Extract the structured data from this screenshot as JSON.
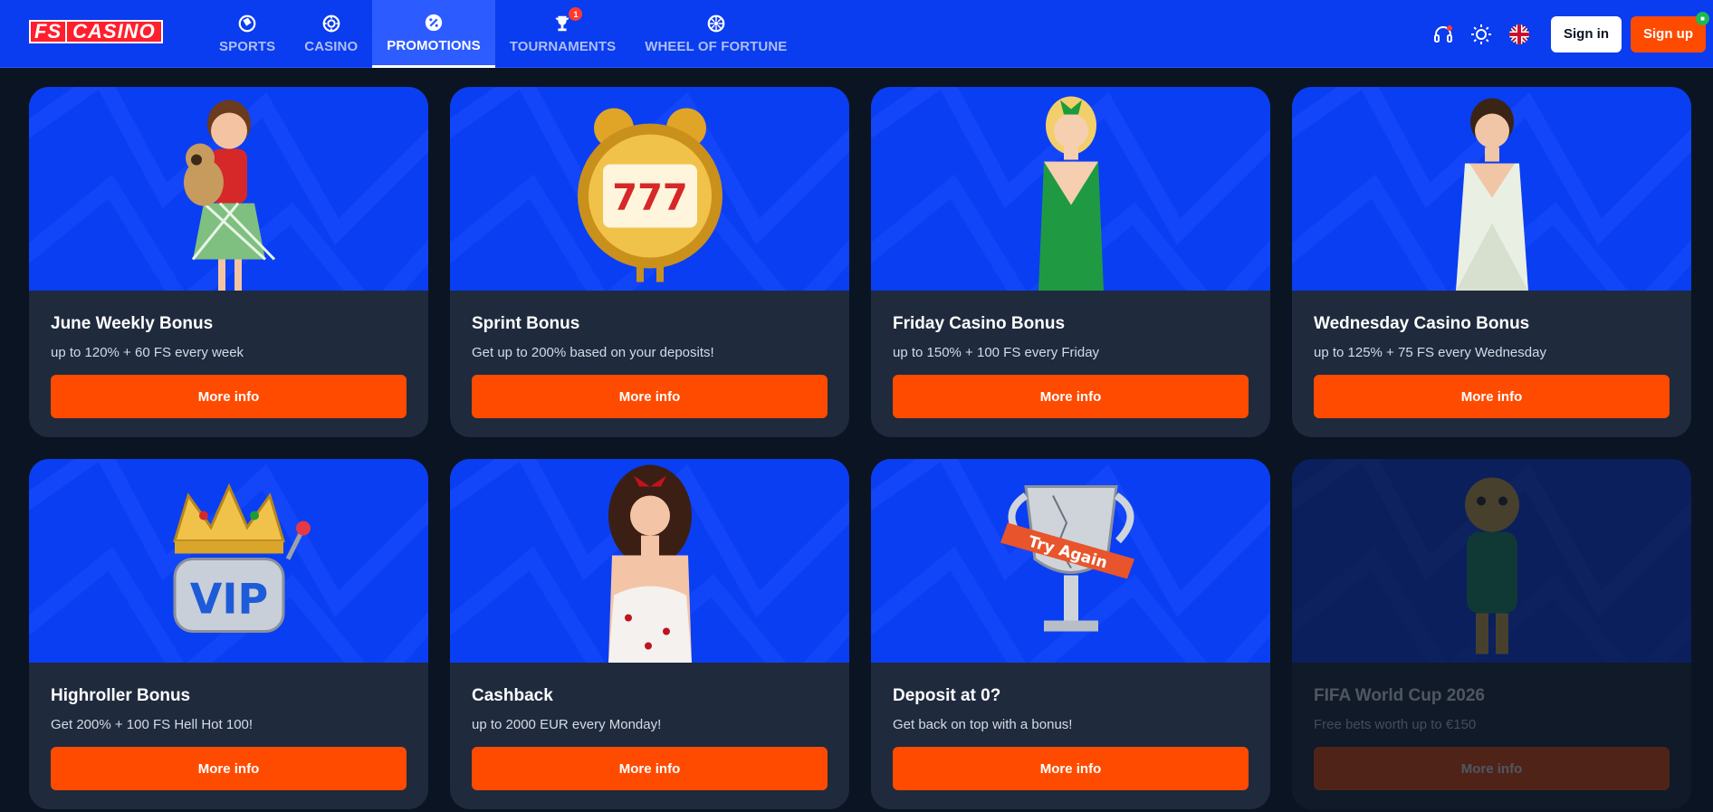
{
  "brand": {
    "logo_left": "FS",
    "logo_right": "CASINO"
  },
  "nav": [
    {
      "label": "SPORTS",
      "icon": "soccer-ball-icon"
    },
    {
      "label": "CASINO",
      "icon": "poker-chip-icon"
    },
    {
      "label": "PROMOTIONS",
      "icon": "percent-badge-icon",
      "active": true
    },
    {
      "label": "TOURNAMENTS",
      "icon": "trophy-icon",
      "badge": "1"
    },
    {
      "label": "WHEEL OF FORTUNE",
      "icon": "wheel-icon"
    }
  ],
  "header_right": {
    "support_icon": "headset-icon",
    "theme_icon": "sun-icon",
    "language_icon": "uk-flag-icon",
    "sign_in": "Sign in",
    "sign_up": "Sign up"
  },
  "promotions": [
    {
      "title": "June Weekly Bonus",
      "subtitle": "up to 120% + 60 FS every week",
      "button": "More info",
      "art": "girl-with-pug"
    },
    {
      "title": "Sprint Bonus",
      "subtitle": "Get up to 200% based on your deposits!",
      "button": "More info",
      "art": "alarm-clock-777"
    },
    {
      "title": "Friday Casino Bonus",
      "subtitle": "up to 150% + 100 FS every Friday",
      "button": "More info",
      "art": "blonde-green-dress"
    },
    {
      "title": "Wednesday Casino Bonus",
      "subtitle": "up to 125% + 75 FS every Wednesday",
      "button": "More info",
      "art": "lady-white-dress"
    },
    {
      "title": "Highroller Bonus",
      "subtitle": "Get 200% + 100 FS Hell Hot 100!",
      "button": "More info",
      "art": "vip-crown-slot"
    },
    {
      "title": "Cashback",
      "subtitle": "up to 2000 EUR every Monday!",
      "button": "More info",
      "art": "pinup-lady"
    },
    {
      "title": "Deposit at 0?",
      "subtitle": "Get back on top with a bonus!",
      "button": "More info",
      "art": "cracked-trophy",
      "ribbon": "Try Again"
    },
    {
      "title": "FIFA World Cup 2026",
      "subtitle": "Free bets worth up to €150",
      "button": "More info",
      "art": "jaguar-mascot",
      "faded": true
    }
  ],
  "colors": {
    "header_bg": "#0a3cf0",
    "page_bg": "#0b1422",
    "card_bg": "#1f2a3d",
    "card_image_bg": "#0a3ef2",
    "accent": "#ff4b00"
  }
}
